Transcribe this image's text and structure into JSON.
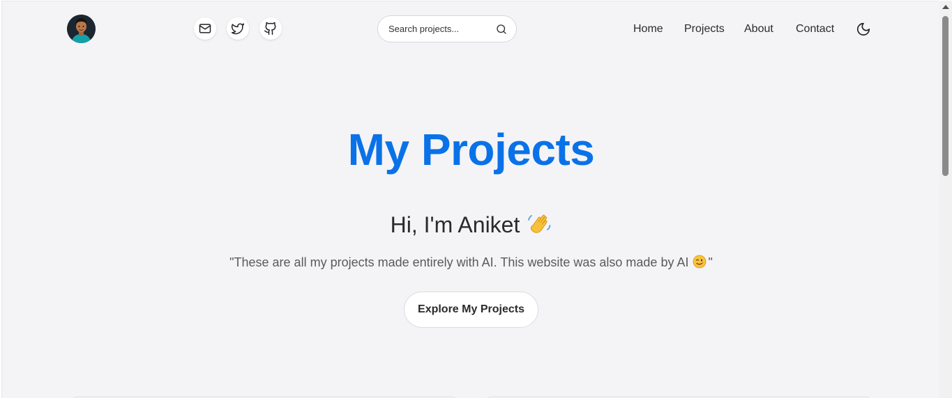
{
  "header": {
    "avatar_alt": "avatar",
    "social": [
      {
        "icon": "mail-icon"
      },
      {
        "icon": "twitter-icon"
      },
      {
        "icon": "github-icon"
      }
    ],
    "search": {
      "placeholder": "Search projects...",
      "value": ""
    },
    "nav": [
      "Home",
      "Projects",
      "About",
      "Contact"
    ],
    "theme_toggle_icon": "moon-icon"
  },
  "hero": {
    "title": "My Projects",
    "greeting": "Hi, I'm Aniket",
    "greeting_emoji": "waving-hand",
    "quote_open": "\"These are all my projects made entirely with AI. This website was also made by AI",
    "quote_emoji": "winking-face",
    "quote_close": "\"",
    "cta_label": "Explore My Projects"
  },
  "colors": {
    "accent": "#0a72e8",
    "background": "#f4f4f6",
    "text": "#2a2a2a"
  }
}
